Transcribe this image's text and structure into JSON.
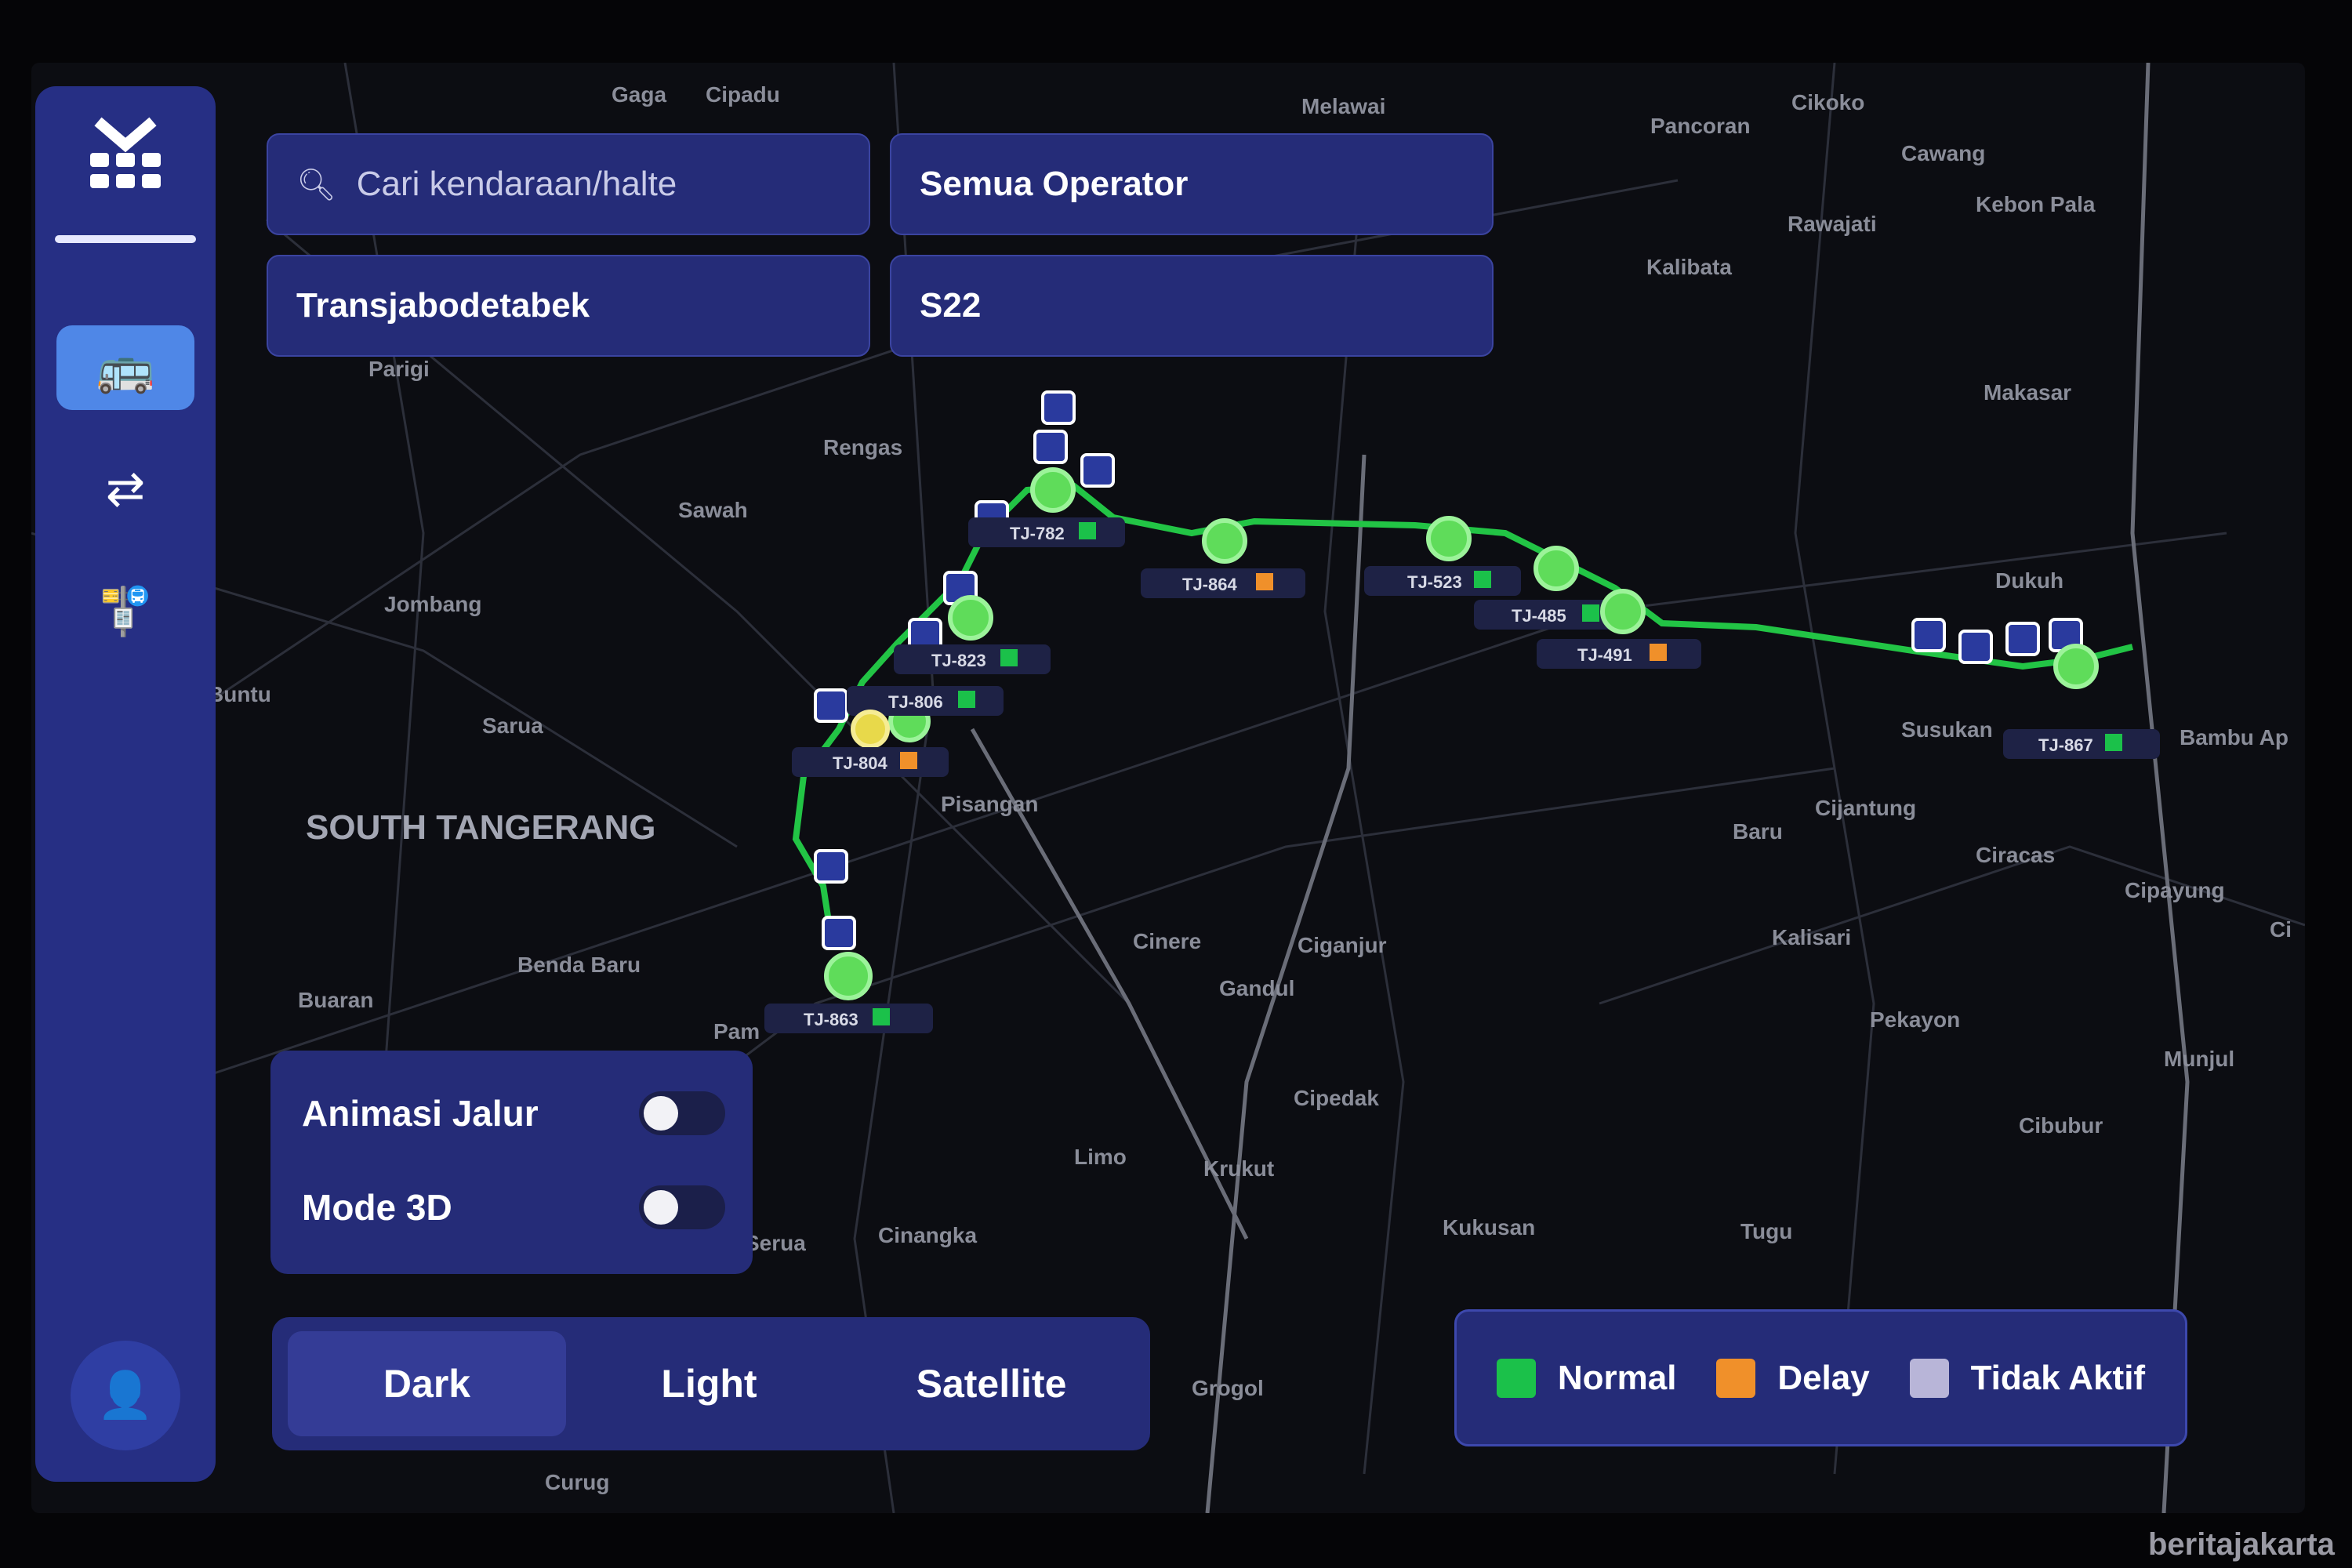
{
  "search": {
    "placeholder": "Cari kendaraan/halte"
  },
  "filters": {
    "operator": "Semua Operator",
    "company": "Transjabodetabek",
    "route": "S22"
  },
  "sidebar": {
    "items": [
      {
        "name": "bus-icon",
        "glyph": "🚌"
      },
      {
        "name": "transfer-icon",
        "glyph": "⇄"
      },
      {
        "name": "stop-icon",
        "glyph": "🚏"
      }
    ],
    "profile_glyph": "👤"
  },
  "toggles": {
    "animasi_label": "Animasi Jalur",
    "animasi_on": false,
    "mode3d_label": "Mode 3D",
    "mode3d_on": false
  },
  "map_styles": {
    "dark": "Dark",
    "light": "Light",
    "satellite": "Satellite",
    "selected": "Dark"
  },
  "legend": [
    {
      "label": "Normal",
      "color": "#1bc14a"
    },
    {
      "label": "Delay",
      "color": "#f0902a"
    },
    {
      "label": "Tidak Aktif",
      "color": "#b8b5d8"
    }
  ],
  "map": {
    "route_color": "#22c445",
    "places": [
      "Gaga",
      "Cipadu",
      "Melawai",
      "Pancoran",
      "Cikoko",
      "Cawang",
      "Kebon Pala",
      "Rawajati",
      "Kalibata",
      "Makasar",
      "Parigi",
      "Rengas",
      "Sawah",
      "Jombang",
      "Buntu",
      "Sarua",
      "SOUTH TANGERANG",
      "Pisangan",
      "Dukuh",
      "Susukan",
      "Bambu Ap",
      "Baru",
      "Cijantung",
      "Ciracas",
      "Cipayung",
      "Kalisari",
      "Cinere",
      "Ciganjur",
      "Gandul",
      "Benda Baru",
      "Buaran",
      "Pekayon",
      "Munjul",
      "Cipedak",
      "Cibubur",
      "Limo",
      "Krukut",
      "Kukusan",
      "Tugu",
      "Cinangka",
      "Grogol",
      "Curug",
      "Serua",
      "Pam",
      "Ci"
    ],
    "buses": [
      {
        "id": "TJ-782",
        "status": "Normal"
      },
      {
        "id": "TJ-864",
        "status": "Delay"
      },
      {
        "id": "TJ-523",
        "status": "Normal"
      },
      {
        "id": "TJ-485",
        "status": "Normal"
      },
      {
        "id": "TJ-491",
        "status": "Delay"
      },
      {
        "id": "TJ-823",
        "status": "Normal"
      },
      {
        "id": "TJ-806",
        "status": "Normal"
      },
      {
        "id": "TJ-804",
        "status": "Delay"
      },
      {
        "id": "TJ-863",
        "status": "Normal"
      },
      {
        "id": "TJ-867",
        "status": "Normal"
      }
    ]
  },
  "watermark": "beritajakarta"
}
